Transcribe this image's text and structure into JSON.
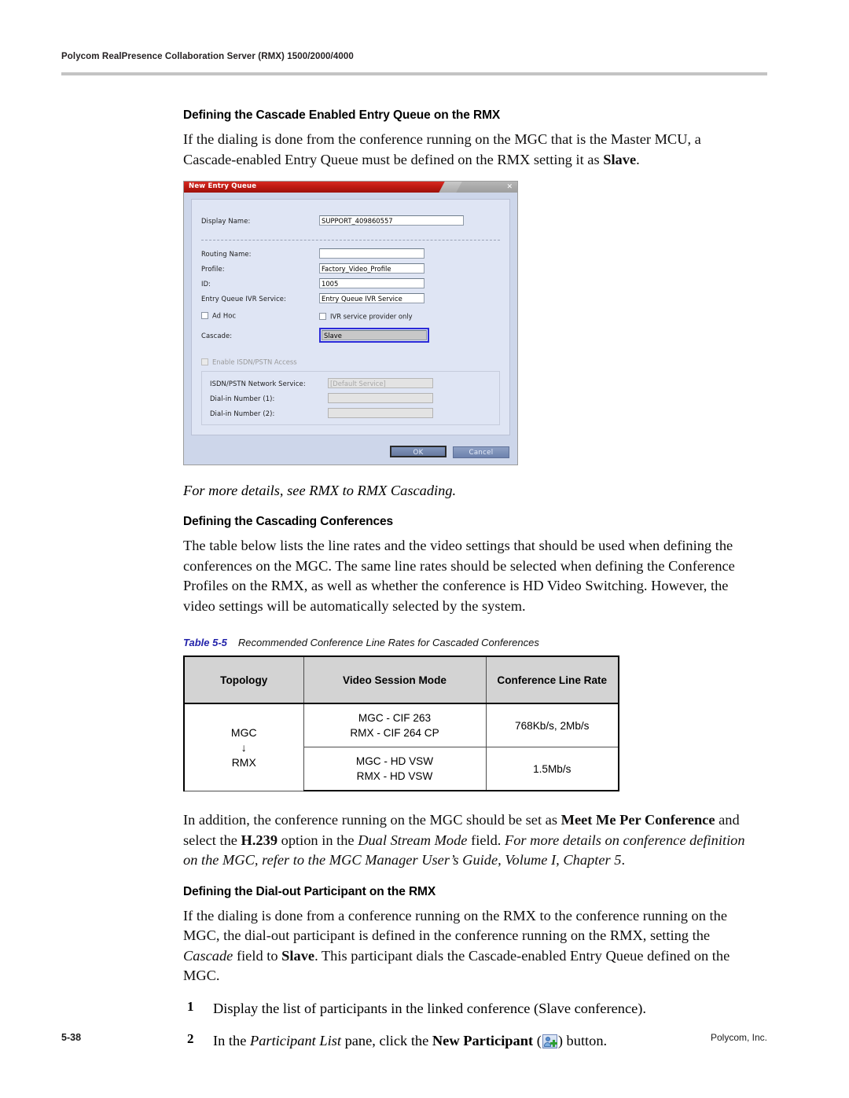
{
  "header": {
    "running_head": "Polycom RealPresence Collaboration Server (RMX) 1500/2000/4000"
  },
  "sections": {
    "entry_queue": {
      "heading": "Defining the Cascade Enabled Entry Queue on the RMX",
      "paragraph_pre": "If the dialing is done from the conference running on the MGC that is the Master MCU, a Cascade-enabled Entry Queue must be defined on the RMX setting it as ",
      "paragraph_bold": "Slave",
      "paragraph_post": "."
    },
    "note": "For more details, see RMX to RMX Cascading.",
    "cascading_conferences": {
      "heading": "Defining the Cascading Conferences",
      "paragraph": "The table below lists the line rates and the video settings that should be used when defining the conferences on the MGC. The same line rates should be selected when defining the Conference Profiles on the RMX, as well as whether the conference is HD Video Switching. However, the video settings will be automatically selected by the system."
    },
    "addition": {
      "t1": "In addition, the conference running on the MGC should be set as ",
      "b1": "Meet Me Per Conference",
      "t2": " and select the ",
      "b2": "H.239",
      "t3": " option in the ",
      "i1": "Dual Stream Mode",
      "t4": " field. ",
      "i2": "For more details on conference definition on the MGC, refer to the MGC Manager User’s Guide, Volume I, Chapter 5",
      "t5": "."
    },
    "dial_out": {
      "heading": "Defining the Dial-out Participant on the RMX",
      "t1": "If the dialing is done from a conference running on the RMX to the conference running on the MGC, the dial-out participant is defined in the conference running on the RMX, setting the ",
      "i1": "Cascade",
      "t2": " field to ",
      "b1": "Slave",
      "t3": ". This participant dials the Cascade-enabled Entry Queue defined on the MGC."
    },
    "steps": [
      {
        "num": "1",
        "text": "Display the list of participants in the linked conference (Slave conference)."
      },
      {
        "num": "2",
        "pre": "In the ",
        "italic": "Participant List",
        "mid": " pane, click the ",
        "bold": "New Participant",
        "paren_open": " (",
        "icon": "new-participant-icon",
        "paren_close": ") button."
      }
    ]
  },
  "dialog": {
    "title": "New Entry Queue",
    "close_glyph": "✕",
    "fields": {
      "display_name_label": "Display Name:",
      "display_name_value": "SUPPORT_409860557",
      "routing_name_label": "Routing Name:",
      "routing_name_value": "",
      "profile_label": "Profile:",
      "profile_value": "Factory_Video_Profile",
      "id_label": "ID:",
      "id_value": "1005",
      "ivr_service_label": "Entry Queue IVR Service:",
      "ivr_service_value": "Entry Queue IVR Service",
      "ad_hoc_label": "Ad Hoc",
      "ivr_provider_label": "IVR service provider only",
      "cascade_label": "Cascade:",
      "cascade_value": "Slave",
      "enable_isdn_label": "Enable ISDN/PSTN Access",
      "isdn_network_label": "ISDN/PSTN Network Service:",
      "isdn_network_value": "[Default Service]",
      "dial_in_1_label": "Dial-in Number (1):",
      "dial_in_1_value": "",
      "dial_in_2_label": "Dial-in Number (2):",
      "dial_in_2_value": ""
    },
    "buttons": {
      "ok": "OK",
      "cancel": "Cancel"
    },
    "colors": {
      "titlebar_red": "#c01a12",
      "panel": "#dfe5f4",
      "dialog_bg": "#cdd6ea",
      "cascade_highlight": "#2b2bd8"
    }
  },
  "table": {
    "caption_number": "Table 5-5",
    "caption_title": "Recommended Conference Line Rates for Cascaded Conferences",
    "headers": [
      "Topology",
      "Video Session Mode",
      "Conference Line Rate"
    ],
    "topology": {
      "from": "MGC",
      "arrow": "↓",
      "to": "RMX"
    },
    "rows": [
      {
        "mode_line1": "MGC - CIF 263",
        "mode_line2": "RMX - CIF 264 CP",
        "rate": "768Kb/s, 2Mb/s"
      },
      {
        "mode_line1": "MGC - HD VSW",
        "mode_line2": "RMX - HD VSW",
        "rate": "1.5Mb/s"
      }
    ]
  },
  "footer": {
    "page_number": "5-38",
    "company": "Polycom, Inc."
  }
}
